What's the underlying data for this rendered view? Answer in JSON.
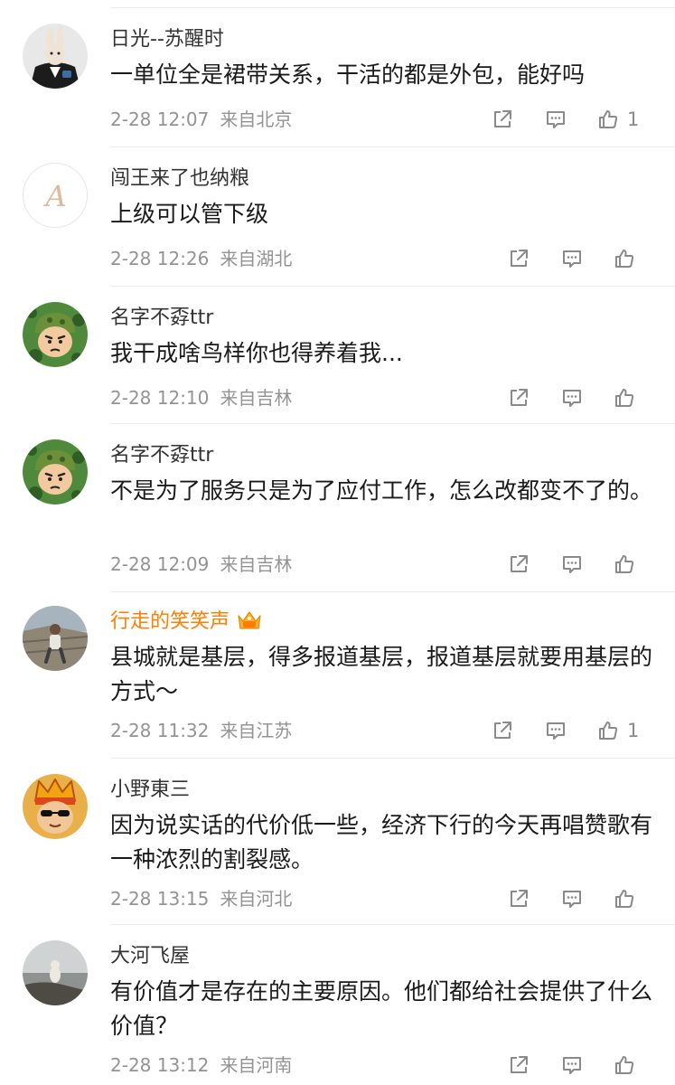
{
  "comments": [
    {
      "name": "日光--苏醒时",
      "text": "一单位全是裙带关系，干活的都是外包，能好吗",
      "time": "2-28 12:07",
      "location": "来自北京",
      "likes": "1",
      "avatar": "avatar-tuxedo-rabbit"
    },
    {
      "name": "闯王来了也纳粮",
      "text": "上级可以管下级",
      "time": "2-28 12:26",
      "location": "来自湖北",
      "likes": "",
      "avatar": "avatar-letter-a",
      "avatar_letter": "A"
    },
    {
      "name": "名字不孬ttr",
      "text": "我干成啥鸟样你也得养着我...",
      "time": "2-28 12:10",
      "location": "来自吉林",
      "likes": "",
      "avatar": "avatar-cartoon-soldier"
    },
    {
      "name": "名字不孬ttr",
      "text": "不是为了服务只是为了应付工作，怎么改都变不了的。",
      "time": "2-28 12:09",
      "location": "来自吉林",
      "likes": "",
      "avatar": "avatar-cartoon-soldier"
    },
    {
      "name": "行走的笑笑声",
      "text": "县城就是基层，得多报道基层，报道基层就要用基层的方式～",
      "time": "2-28 11:32",
      "location": "来自江苏",
      "likes": "1",
      "avatar": "avatar-great-wall-photo",
      "vip": true
    },
    {
      "name": "小野東三",
      "text": "因为说实话的代价低一些，经济下行的今天再唱赞歌有一种浓烈的割裂感。",
      "time": "2-28 13:15",
      "location": "来自河北",
      "likes": "",
      "avatar": "avatar-crown-sunglasses"
    },
    {
      "name": "大河飞屋",
      "text": "有价值才是存在的主要原因。他们都给社会提供了什么价值？",
      "time": "2-28 13:12",
      "location": "来自河南",
      "likes": "",
      "avatar": "avatar-cliff-photo"
    }
  ],
  "colors": {
    "name": "#333333",
    "vip_name": "#ff7f00",
    "meta": "#939393",
    "icon": "#8a8a8a"
  }
}
